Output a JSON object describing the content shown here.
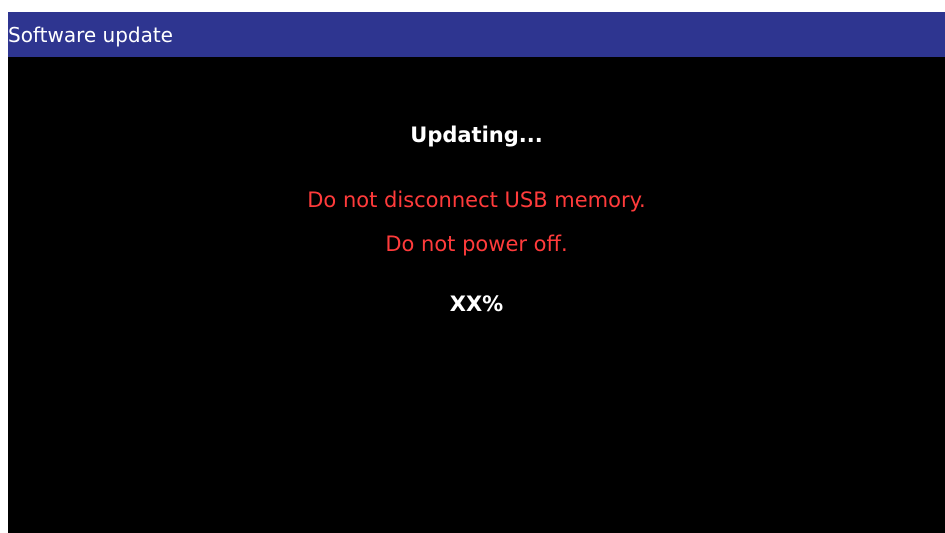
{
  "window": {
    "title": "Software update"
  },
  "status": {
    "heading": "Updating...",
    "warning_usb": "Do not disconnect USB memory.",
    "warning_power": "Do not power off.",
    "progress_text": "XX%"
  },
  "colors": {
    "title_bar": "#2e3590",
    "background": "#000000",
    "text": "#ffffff",
    "warning": "#ff3b3b"
  }
}
